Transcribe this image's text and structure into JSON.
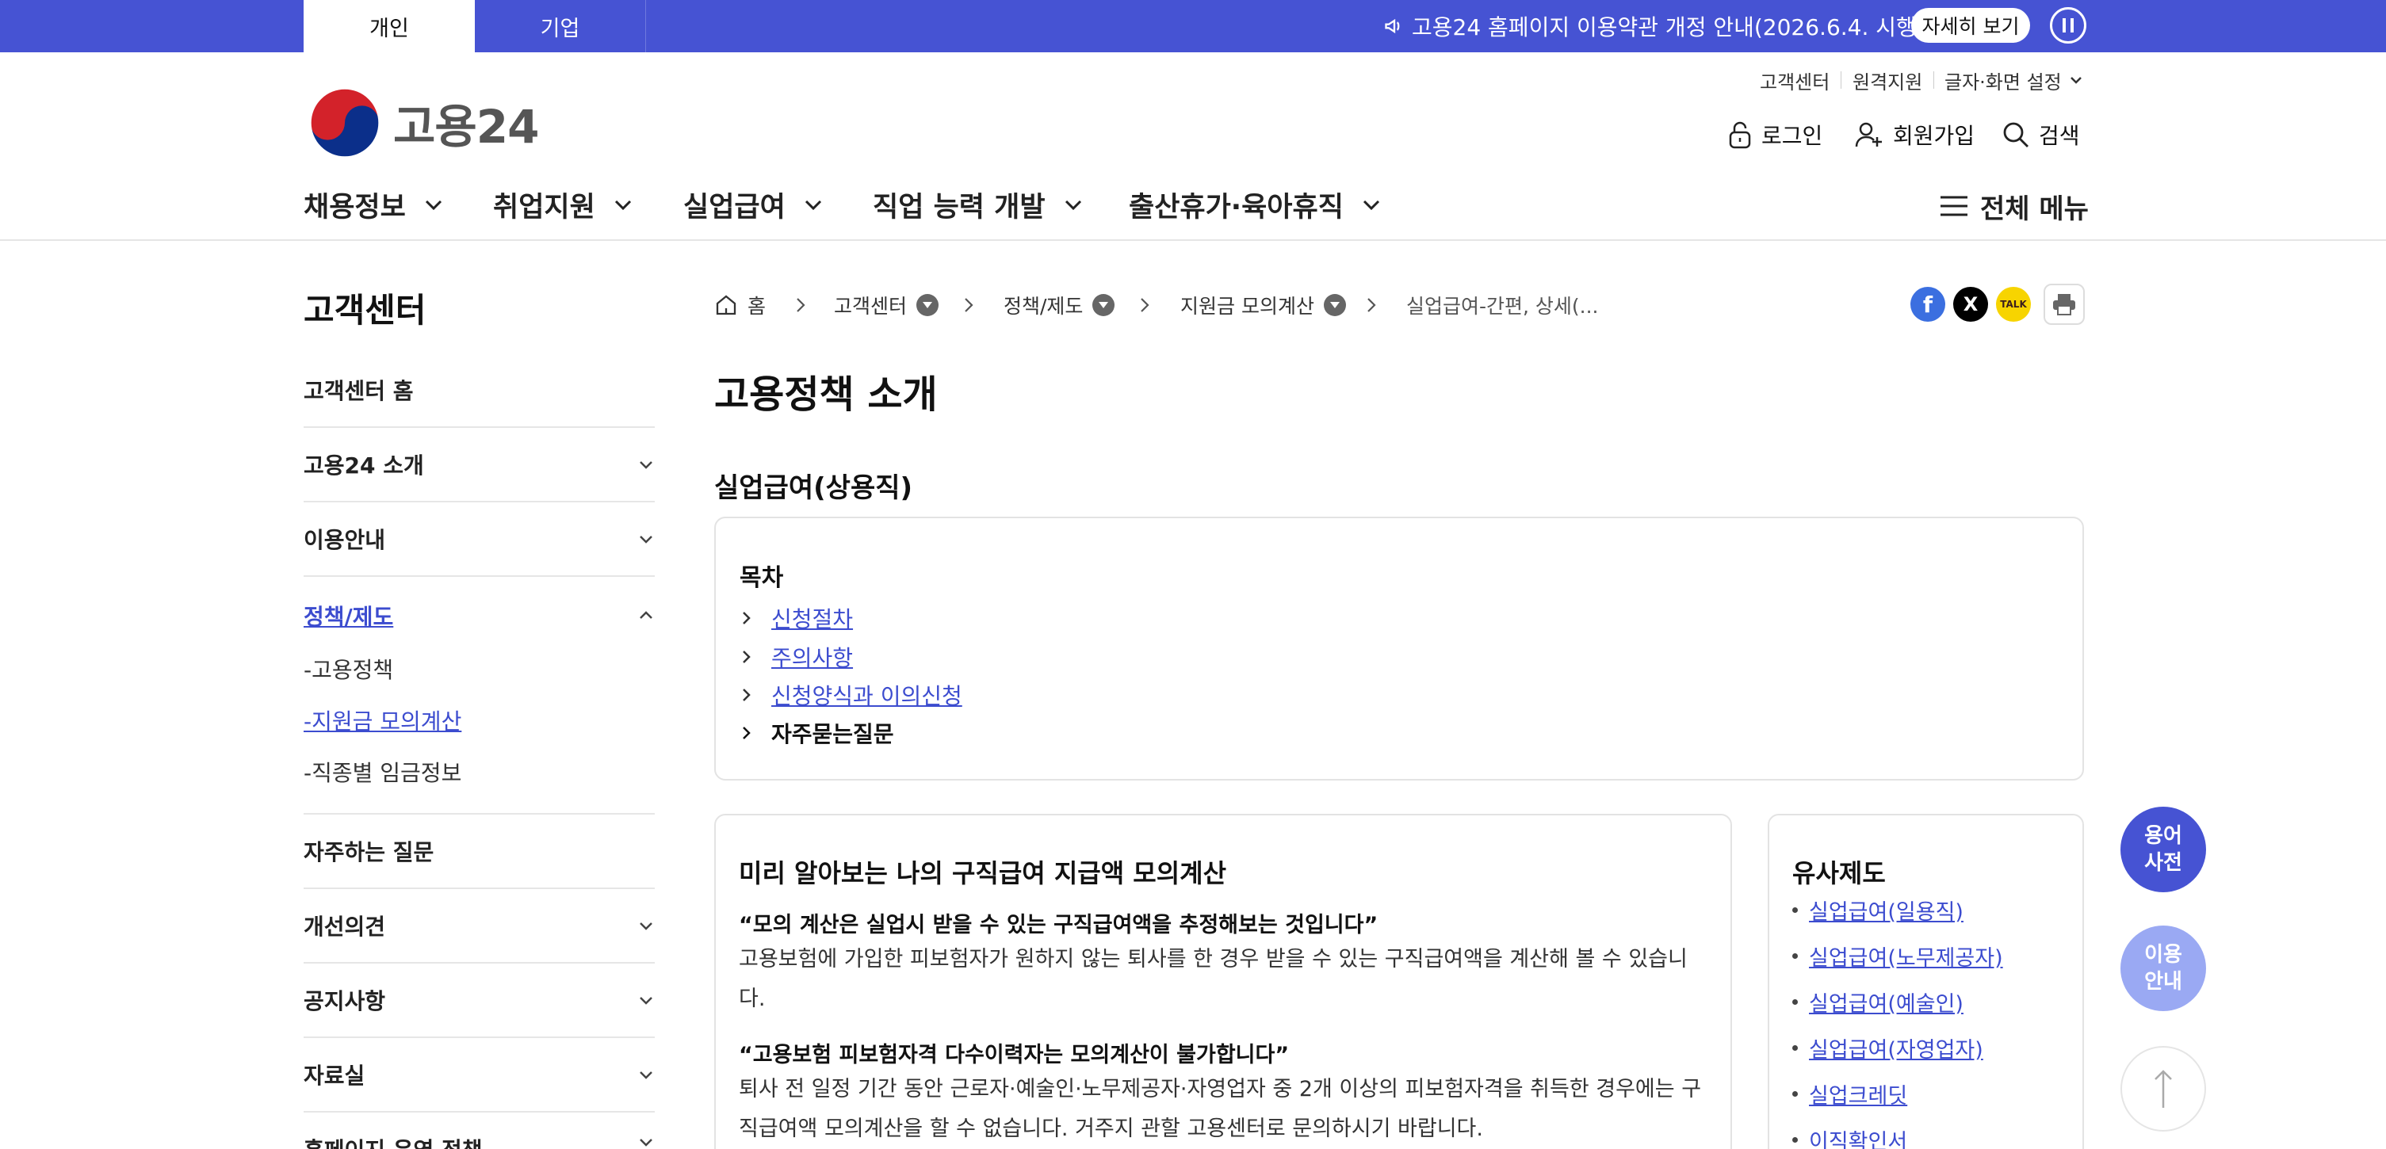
{
  "topbar": {
    "tabs": [
      "개인",
      "기업"
    ],
    "notice_text": "고용24 홈페이지 이용약관 개정 안내(2026.6.4. 시행)",
    "notice_button": "자세히 보기",
    "colors": {
      "bar": "#4653d3"
    }
  },
  "header": {
    "logo_text": "고용24",
    "util_links": [
      "고객센터",
      "원격지원",
      "글자·화면 설정"
    ],
    "actions": {
      "login": "로그인",
      "signup": "회원가입",
      "search": "검색"
    }
  },
  "gnb": {
    "items": [
      "채용정보",
      "취업지원",
      "실업급여",
      "직업 능력 개발",
      "출산휴가·육아휴직"
    ],
    "all_menu": "전체 메뉴"
  },
  "sidebar": {
    "title": "고객센터",
    "items": [
      "고객센터 홈",
      "고용24 소개",
      "이용안내",
      "정책/제도",
      "자주하는 질문",
      "개선의견",
      "공지사항",
      "자료실",
      "홈페이지 운영 정책"
    ],
    "sub_items": [
      "-고용정책",
      "-지원금 모의계산",
      "-직종별 임금정보"
    ]
  },
  "breadcrumb": {
    "items": [
      "홈",
      "고객센터",
      "정책/제도",
      "지원금 모의계산",
      "실업급여-간편, 상세(..."
    ]
  },
  "share": {
    "kakao_label": "TALK"
  },
  "content": {
    "page_title": "고용정책 소개",
    "section_title": "실업급여(상용직)",
    "toc": {
      "title": "목차",
      "items": [
        "신청절차",
        "주의사항",
        "신청양식과 이의신청",
        "자주묻는질문"
      ]
    },
    "calc": {
      "title": "미리 알아보는 나의 구직급여 지급액 모의계산",
      "q1": "“모의 계산은 실업시 받을 수 있는 구직급여액을 추정해보는 것입니다”",
      "p1_line1": "고용보험에 가입한 피보험자가 원하지 않는 퇴사를 한 경우 받을 수 있는 구직급여액을 계산해 볼 수 있습니",
      "p1_line2": "다.",
      "q2": "“고용보험 피보험자격 다수이력자는 모의계산이 불가합니다”",
      "p2_line1": "퇴사 전 일정 기간 동안 근로자·예술인·노무제공자·자영업자 중 2개 이상의 피보험자격을 취득한 경우에는 구",
      "p2_line2": "직급여액 모의계산을 할 수 없습니다. 거주지 관할 고용센터로 문의하시기 바랍니다."
    },
    "similar": {
      "title": "유사제도",
      "items": [
        "실업급여(일용직)",
        "실업급여(노무제공자)",
        "실업급여(예술인)",
        "실업급여(자영업자)",
        "실업크레딧",
        "이직확인서"
      ]
    }
  },
  "floating": {
    "glossary": [
      "용어",
      "사전"
    ],
    "guide": [
      "이용",
      "안내"
    ]
  }
}
